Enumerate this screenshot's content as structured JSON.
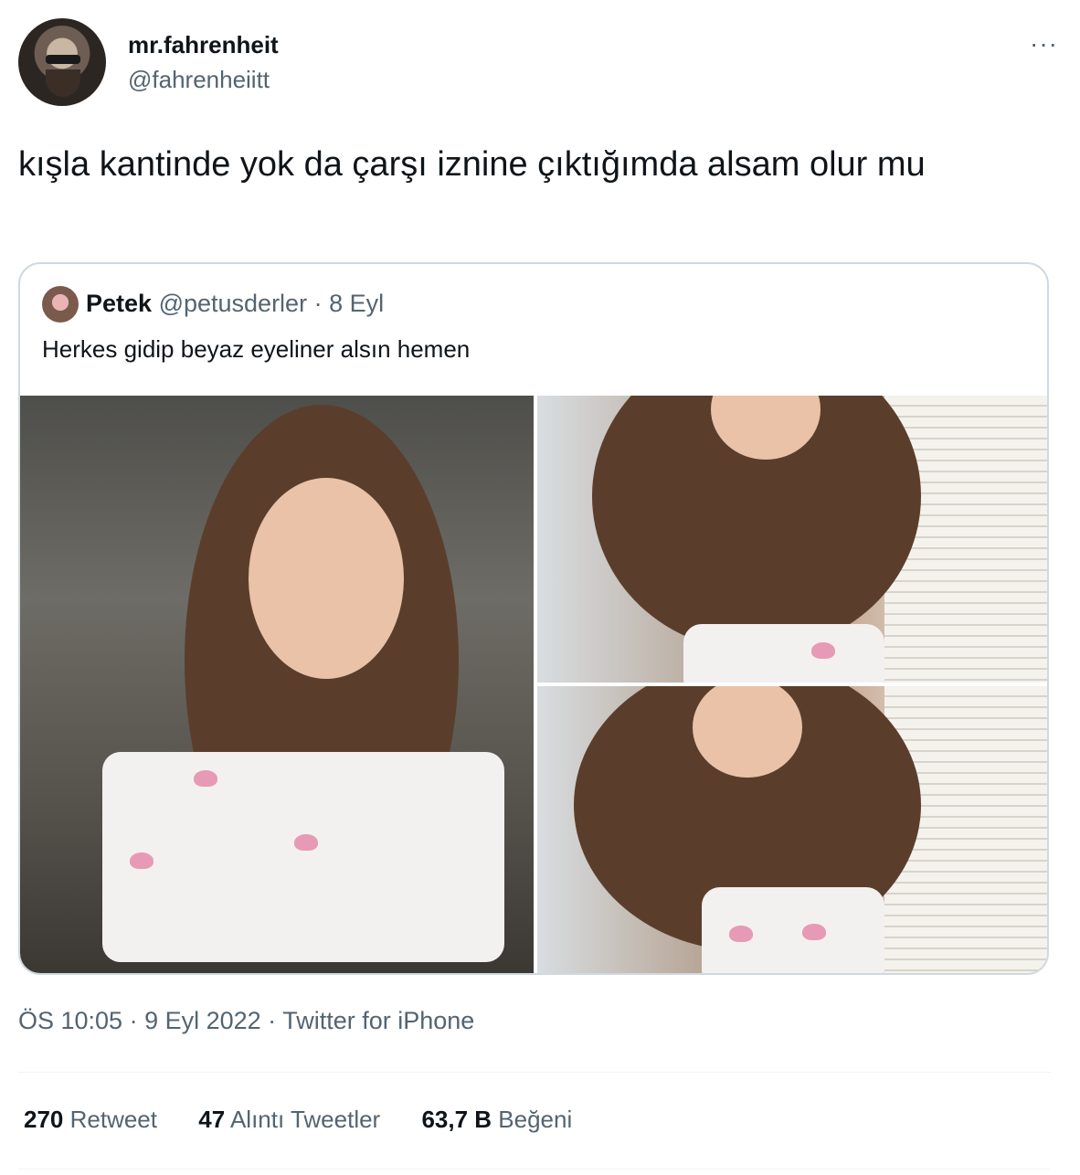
{
  "author": {
    "display_name": "mr.fahrenheit",
    "handle": "@fahrenheiitt"
  },
  "more_icon": "···",
  "tweet": {
    "text": "kışla kantinde yok da çarşı iznine çıktığımda alsam olur mu"
  },
  "quoted": {
    "name": "Petek",
    "handle": "@petusderler",
    "separator": " · ",
    "date": "8 Eyl",
    "text": "Herkes gidip beyaz eyeliner alsın hemen",
    "media_count": 3
  },
  "meta": {
    "time": "ÖS 10:05",
    "dot1": " · ",
    "date": "9 Eyl 2022",
    "dot2": " · ",
    "source": "Twitter for iPhone"
  },
  "stats": {
    "retweets_count": "270",
    "retweets_label": " Retweet",
    "quotes_count": "47",
    "quotes_label": " Alıntı Tweetler",
    "likes_count": "63,7 B",
    "likes_label": " Beğeni"
  },
  "colors": {
    "text_primary": "#0f1419",
    "text_secondary": "#536471",
    "border": "#cfd9de"
  }
}
